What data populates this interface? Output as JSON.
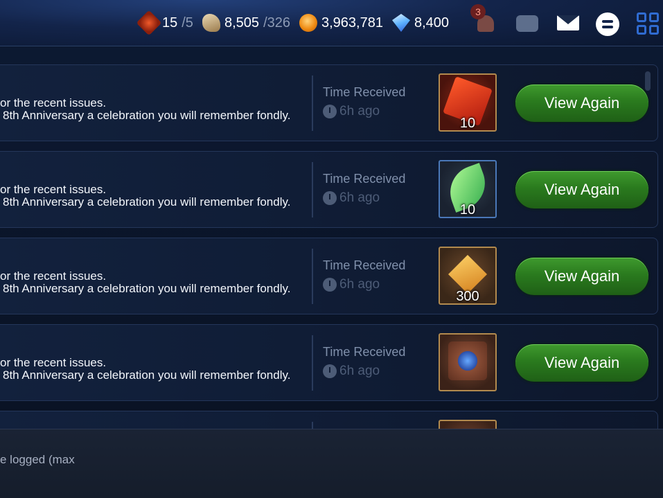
{
  "resources": [
    {
      "icon": "stamina-sword-icon",
      "value": "15",
      "max": "/5"
    },
    {
      "icon": "horse-stamina-icon",
      "value": "8,505",
      "max": "/326"
    },
    {
      "icon": "gold-coin-icon",
      "value": "3,963,781",
      "max": ""
    },
    {
      "icon": "crystal-gem-icon",
      "value": "8,400",
      "max": ""
    }
  ],
  "notifications": {
    "badge": "3"
  },
  "mails": [
    {
      "line1": "or the recent issues.",
      "line2": "8th Anniversary a celebration you will remember fondly.",
      "time_label": "Time Received",
      "time_value": "6h ago",
      "item_qty": "10",
      "item_icon": "red-rune-chest-icon",
      "button": "View Again"
    },
    {
      "line1": "or the recent issues.",
      "line2": "8th Anniversary a celebration you will remember fondly.",
      "time_label": "Time Received",
      "time_value": "6h ago",
      "item_qty": "10",
      "item_icon": "green-leaf-icon",
      "button": "View Again"
    },
    {
      "line1": "or the recent issues.",
      "line2": "8th Anniversary a celebration you will remember fondly.",
      "time_label": "Time Received",
      "time_value": "6h ago",
      "item_qty": "300",
      "item_icon": "gold-fist-emblem-icon",
      "button": "View Again"
    },
    {
      "line1": "or the recent issues.",
      "line2": "8th Anniversary a celebration you will remember fondly.",
      "time_label": "Time Received",
      "time_value": "6h ago",
      "item_qty": "",
      "item_icon": "blue-flower-tome-icon",
      "button": "View Again"
    }
  ],
  "footer": {
    "note": "e logged (max"
  }
}
